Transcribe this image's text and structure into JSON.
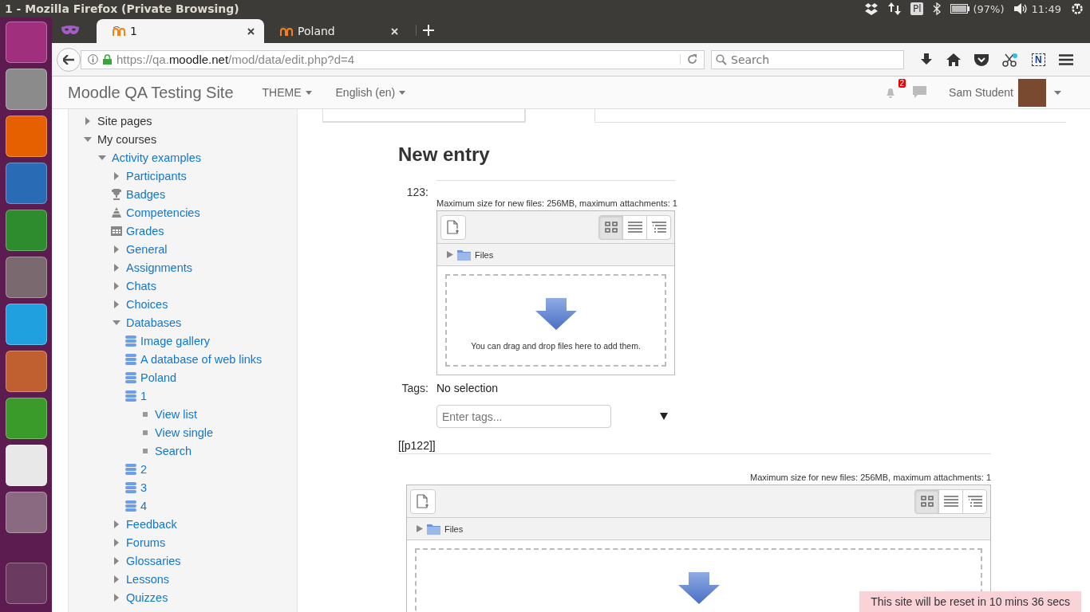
{
  "system_bar": {
    "window_title": "1 - Mozilla Firefox (Private Browsing)",
    "keyboard": "Pl",
    "battery": "(97%)",
    "time": "11:49"
  },
  "browser_tabs": [
    {
      "label": "1",
      "selected": true
    },
    {
      "label": "Poland",
      "selected": false
    }
  ],
  "toolbar": {
    "url": {
      "prefix": "https://qa.",
      "domain": "moodle.net",
      "path": "/mod/data/edit.php?d=4"
    },
    "search_placeholder": "Search",
    "extension_label": "N"
  },
  "navbar": {
    "site_name": "Moodle QA Testing Site",
    "menus": [
      "THEME",
      "English (en)"
    ],
    "notification_count": "2",
    "user_name": "Sam Student"
  },
  "nav_tree": [
    {
      "label": "Site pages",
      "kind": "node",
      "expanded": false
    },
    {
      "label": "My courses",
      "kind": "node",
      "expanded": true,
      "children": [
        {
          "label": "Activity examples",
          "kind": "node",
          "expanded": true,
          "children": [
            {
              "label": "Participants",
              "kind": "node",
              "expanded": false
            },
            {
              "label": "Badges",
              "kind": "trophy"
            },
            {
              "label": "Competencies",
              "kind": "pyramid"
            },
            {
              "label": "Grades",
              "kind": "table"
            },
            {
              "label": "General",
              "kind": "node",
              "expanded": false
            },
            {
              "label": "Assignments",
              "kind": "node",
              "expanded": false
            },
            {
              "label": "Chats",
              "kind": "node",
              "expanded": false
            },
            {
              "label": "Choices",
              "kind": "node",
              "expanded": false
            },
            {
              "label": "Databases",
              "kind": "node",
              "expanded": true,
              "children": [
                {
                  "label": "Image gallery",
                  "kind": "database"
                },
                {
                  "label": "A database of web links",
                  "kind": "database"
                },
                {
                  "label": "Poland",
                  "kind": "database"
                },
                {
                  "label": "1",
                  "kind": "database",
                  "children": [
                    {
                      "label": "View list",
                      "kind": "bullet"
                    },
                    {
                      "label": "View single",
                      "kind": "bullet"
                    },
                    {
                      "label": "Search",
                      "kind": "bullet"
                    }
                  ]
                },
                {
                  "label": "2",
                  "kind": "database"
                },
                {
                  "label": "3",
                  "kind": "database"
                },
                {
                  "label": "4",
                  "kind": "database"
                }
              ]
            },
            {
              "label": "Feedback",
              "kind": "node",
              "expanded": false
            },
            {
              "label": "Forums",
              "kind": "node",
              "expanded": false
            },
            {
              "label": "Glossaries",
              "kind": "node",
              "expanded": false
            },
            {
              "label": "Lessons",
              "kind": "node",
              "expanded": false
            },
            {
              "label": "Quizzes",
              "kind": "node",
              "expanded": false
            }
          ]
        }
      ]
    }
  ],
  "main": {
    "heading": "New entry",
    "file_field": {
      "label": "123:",
      "picker": {
        "max_size_note": "Maximum size for new files: 256MB, maximum attachments: 1",
        "folder_label": "Files",
        "drop_text": "You can drag and drop files here to add them.",
        "views": [
          {
            "kind": "icons",
            "selected": true
          },
          {
            "kind": "list",
            "selected": false
          },
          {
            "kind": "tree",
            "selected": false
          }
        ]
      }
    },
    "tags": {
      "label": "Tags:",
      "value": "No selection",
      "placeholder": "Enter tags..."
    },
    "template_field": {
      "label": "[[p122]]",
      "picker": {
        "max_size_note": "Maximum size for new files: 256MB, maximum attachments: 1",
        "folder_label": "Files",
        "views": [
          {
            "kind": "icons",
            "selected": true
          },
          {
            "kind": "list",
            "selected": false
          },
          {
            "kind": "tree",
            "selected": false
          }
        ]
      }
    }
  },
  "reset_notice": "This site will be reset in 10 mins 36 secs"
}
